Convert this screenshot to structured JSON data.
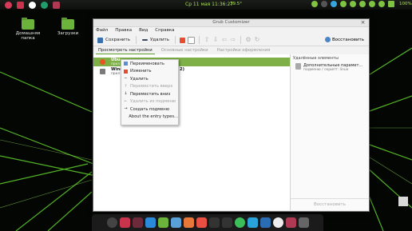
{
  "window": {
    "title": "Grub Customizer",
    "close_glyph": "×"
  },
  "menubar": [
    "Файл",
    "Правка",
    "Вид",
    "Справка"
  ],
  "toolbar": {
    "save_label": "Сохранить",
    "delete_label": "Удалить",
    "restore_label": "Восстановить"
  },
  "tabs": [
    {
      "label": "Просмотреть настройки",
      "active": true
    },
    {
      "label": "Основные настройки",
      "active": false
    },
    {
      "label": "Настройки оформления",
      "active": false
    }
  ],
  "entries": [
    {
      "title": "Ubu",
      "subtitle": "прил",
      "selected": true
    },
    {
      "title": "Wind",
      "subtitle": "прил",
      "suffix": "2)",
      "selected": false
    }
  ],
  "context_menu": [
    {
      "label": "Переименовать",
      "icon": "rename-icon",
      "enabled": true
    },
    {
      "label": "Изменить",
      "icon": "edit-icon",
      "enabled": true
    },
    {
      "label": "Удалить",
      "icon": "remove-icon",
      "enabled": true
    },
    {
      "label": "Переместить вверх",
      "icon": "up-icon",
      "enabled": false
    },
    {
      "label": "Переместить вниз",
      "icon": "down-icon",
      "enabled": true
    },
    {
      "label": "Удалить из подменю",
      "icon": "left-icon",
      "enabled": false
    },
    {
      "label": "Создать подменю",
      "icon": "right-icon",
      "enabled": true
    },
    {
      "label": "About the entry types...",
      "icon": "",
      "enabled": true
    }
  ],
  "sidebar": {
    "title": "Удалённые элементы",
    "item_title": "Дополнительные парамет...",
    "item_subtitle": "подменю / скрипт: linux",
    "restore_label": "Восстановить"
  },
  "desktop": {
    "icons": [
      {
        "label": "Домашняя папка"
      },
      {
        "label": "Загрузки"
      }
    ]
  },
  "top_panel": {
    "clock": "Ср 11 мая 11:36:27",
    "temp": "39.5°",
    "battery": "100%"
  },
  "colors": {
    "accent": "#7fb048",
    "panel_text": "#a7e04e"
  }
}
